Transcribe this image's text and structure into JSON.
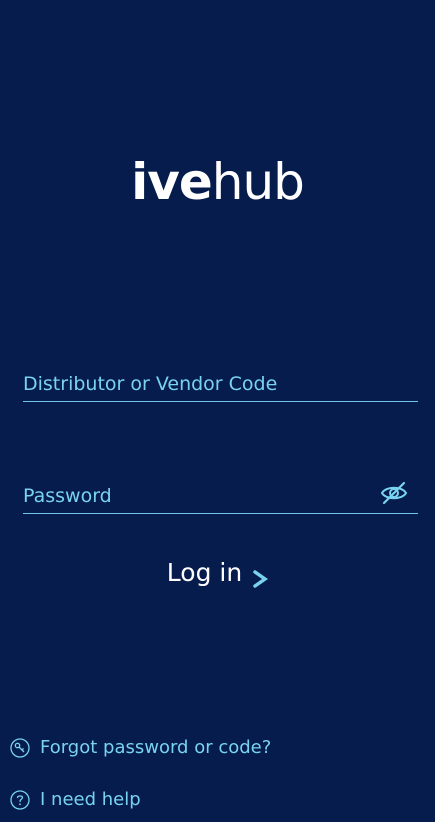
{
  "logo": {
    "part_bold": "ive",
    "part_light": "hub"
  },
  "form": {
    "code_placeholder": "Distributor or Vendor Code",
    "password_placeholder": "Password",
    "login_label": "Log in"
  },
  "links": {
    "forgot": "Forgot password or code?",
    "help": "I need help"
  },
  "icons": {
    "password_toggle": "eye-slash-icon",
    "login_arrow": "chevron-right-icon",
    "forgot": "key-icon",
    "help": "question-circle-icon"
  },
  "colors": {
    "background": "#051c4c",
    "accent": "#79d3f0",
    "text": "#ffffff"
  }
}
